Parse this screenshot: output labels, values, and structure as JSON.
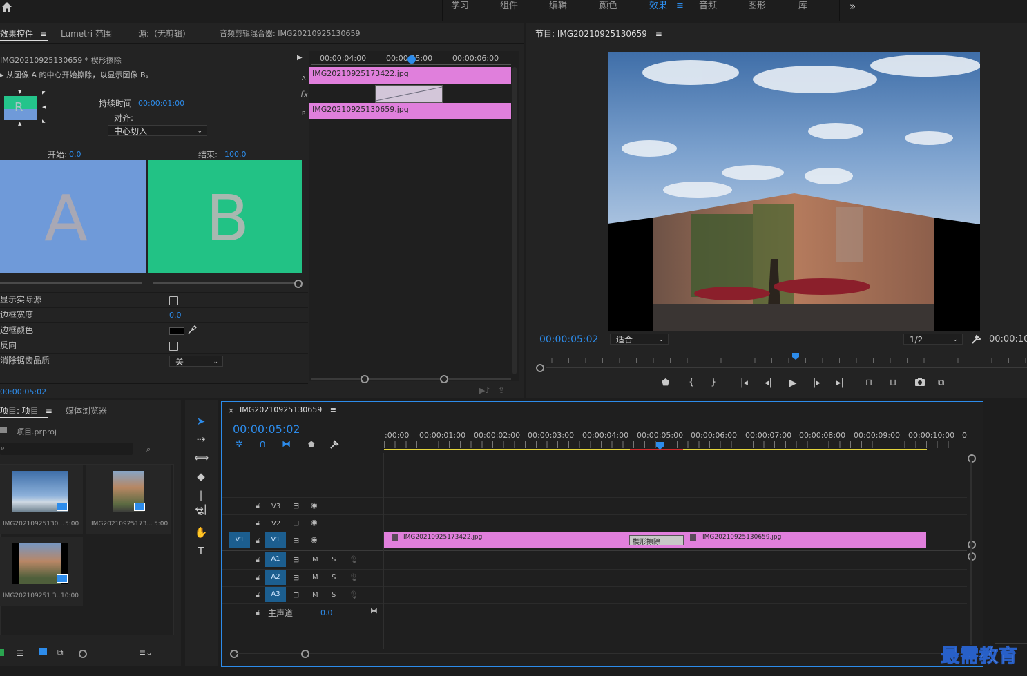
{
  "workspaces": [
    "学习",
    "组件",
    "编辑",
    "颜色",
    "效果",
    "音频",
    "图形",
    "库"
  ],
  "active_workspace": "效果",
  "workspace_menu_icon": "≡",
  "more_icon": "»",
  "effect_controls": {
    "tabs": [
      "效果控件",
      "Lumetri 范围",
      "源:（无剪辑）",
      "音频剪辑混合器: IMG20210925130659"
    ],
    "clip_title": "IMG20210925130659 * 楔形擦除",
    "description": "从图像 A 的中心开始擦除，以显示图像 B。",
    "duration_label": "持续时间",
    "duration_value": "00:00:01:00",
    "align_label": "对齐:",
    "align_value": "中心切入",
    "start_label": "开始:",
    "start_value": "0.0",
    "end_label": "结束:",
    "end_value": "100.0",
    "preview_a": "A",
    "preview_b": "B",
    "preview_thumb": "R",
    "props": [
      {
        "label": "显示实际源",
        "type": "checkbox"
      },
      {
        "label": "边框宽度",
        "type": "value",
        "value": "0.0"
      },
      {
        "label": "边框颜色",
        "type": "color",
        "color": "#000000"
      },
      {
        "label": "反向",
        "type": "checkbox"
      },
      {
        "label": "消除锯齿品质",
        "type": "select",
        "value": "关"
      }
    ],
    "timecode": "00:00:05:02",
    "mini_timeline": {
      "ticks": [
        "00:00:04:00",
        "00:00:05:00",
        "00:00:06:00"
      ],
      "clip_a": "IMG20210925173422.jpg",
      "clip_b": "IMG20210925130659.jpg",
      "track_a": "A",
      "track_b": "B",
      "fx": "fx"
    }
  },
  "program_monitor": {
    "title": "节目: IMG20210925130659",
    "timecode": "00:00:05:02",
    "fit": "适合",
    "resolution": "1/2",
    "right_timecode": "00:00:10"
  },
  "project": {
    "tabs": [
      "项目: 项目",
      "媒体浏览器"
    ],
    "file": "项目.prproj",
    "items": [
      {
        "name": "IMG20210925130...",
        "duration": "5:00"
      },
      {
        "name": "IMG20210925173...",
        "duration": "5:00"
      },
      {
        "name": "IMG202109251 3...",
        "duration": "10:00"
      }
    ]
  },
  "sequence": {
    "close": "×",
    "name": "IMG20210925130659",
    "timecode": "00:00:05:02",
    "ruler": [
      ":00:00",
      "00:00:01:00",
      "00:00:02:00",
      "00:00:03:00",
      "00:00:04:00",
      "00:00:05:00",
      "00:00:06:00",
      "00:00:07:00",
      "00:00:08:00",
      "00:00:09:00",
      "00:00:10:00",
      "0"
    ],
    "video_tracks": [
      "V3",
      "V2",
      "V1"
    ],
    "audio_tracks": [
      "A1",
      "A2",
      "A3"
    ],
    "source_patch_v": "V1",
    "mute": "M",
    "solo": "S",
    "master_label": "主声道",
    "master_value": "0.0",
    "clip_1": "IMG20210925173422.jpg",
    "transition": "楔形擦除",
    "clip_2": "IMG20210925130659.jpg"
  },
  "watermark": "最需教育"
}
